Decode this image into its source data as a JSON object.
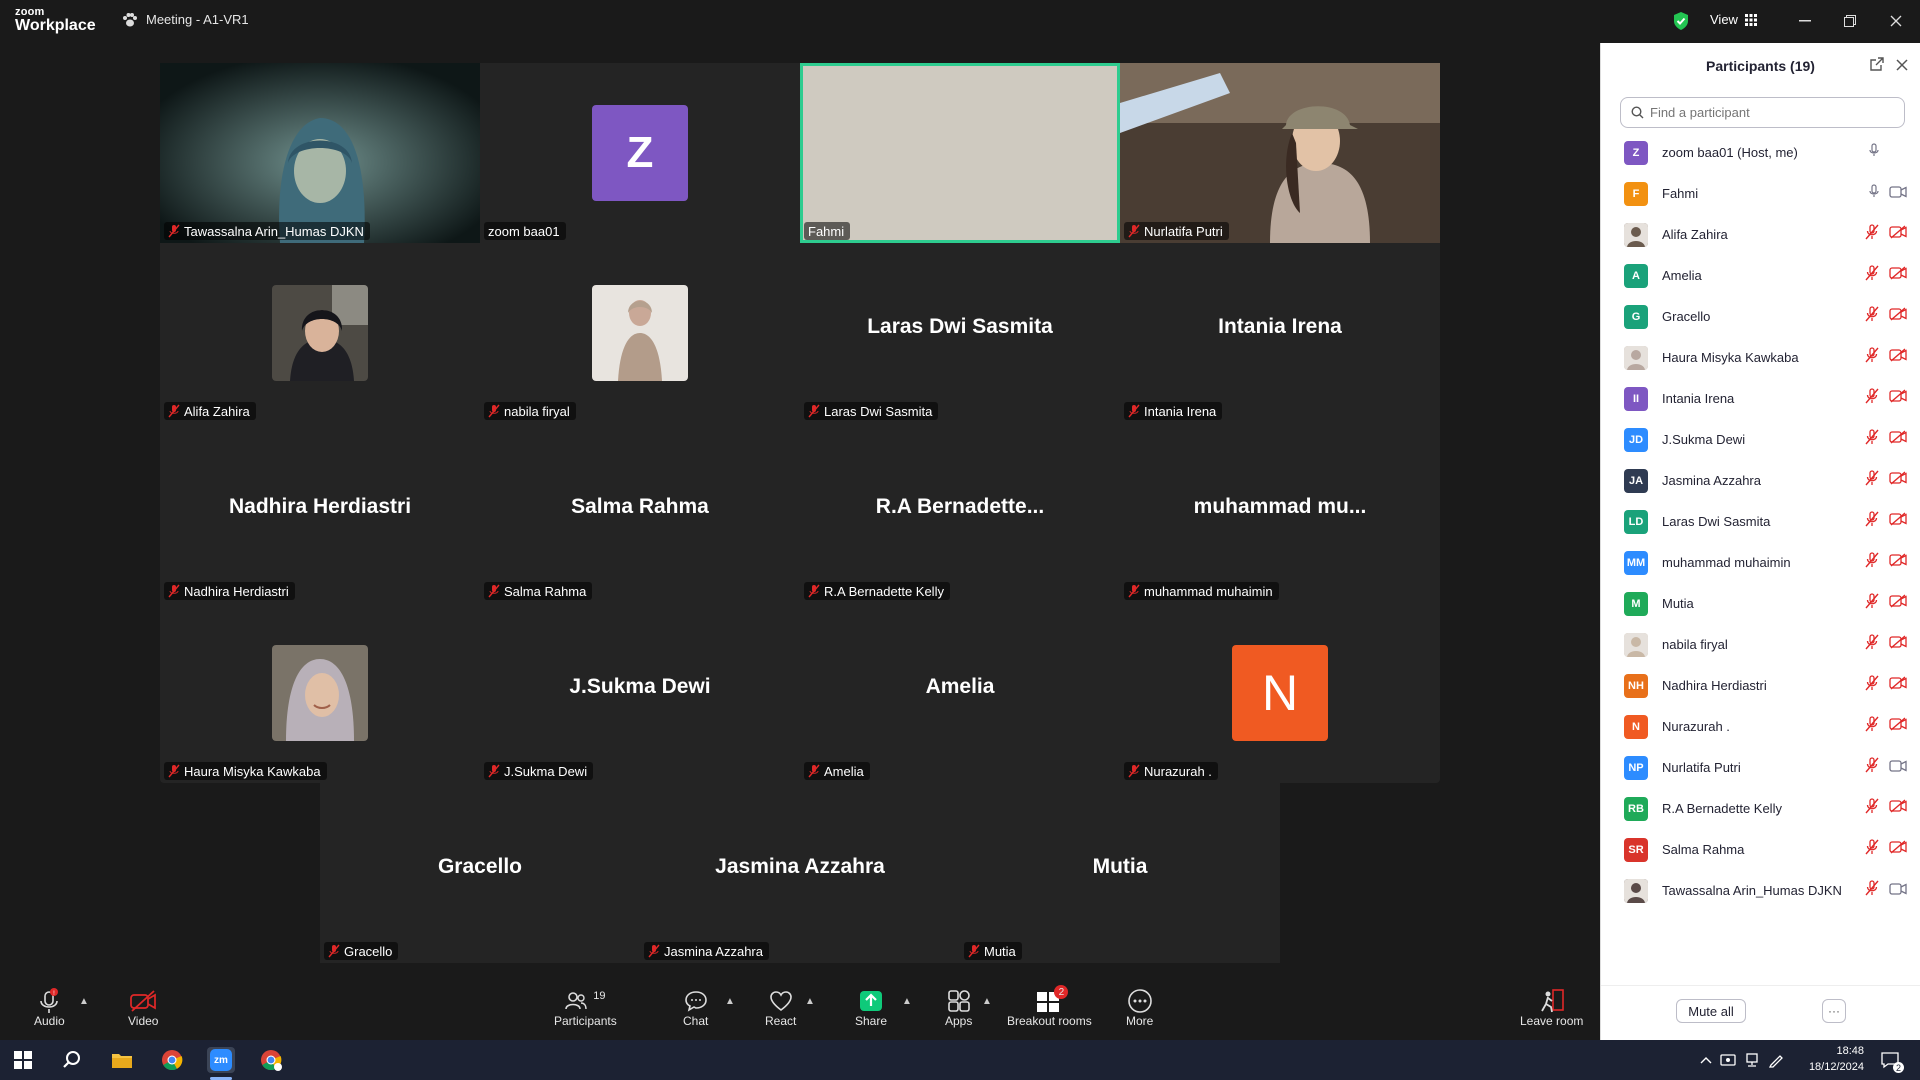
{
  "window": {
    "app_name_top": "zoom",
    "app_name_bottom": "Workplace",
    "meeting_title": "Meeting - A1-VR1",
    "view_label": "View"
  },
  "gallery": {
    "tiles": [
      {
        "name": "Tawassalna Arin_Humas DJKN",
        "big": "",
        "type": "video"
      },
      {
        "name": "zoom baa01",
        "big": "",
        "type": "letter",
        "letter": "Z",
        "color": "#7e57c2"
      },
      {
        "name": "Fahmi",
        "big": "",
        "type": "video-active"
      },
      {
        "name": "Nurlatifa Putri",
        "big": "",
        "type": "video"
      },
      {
        "name": "Alifa Zahira",
        "big": "",
        "type": "photo"
      },
      {
        "name": "nabila firyal",
        "big": "",
        "type": "photo"
      },
      {
        "name": "Laras Dwi Sasmita",
        "big": "Laras Dwi Sasmita",
        "type": "text"
      },
      {
        "name": "Intania Irena",
        "big": "Intania Irena",
        "type": "text"
      },
      {
        "name": "Nadhira Herdiastri",
        "big": "Nadhira Herdiastri",
        "type": "text"
      },
      {
        "name": "Salma Rahma",
        "big": "Salma Rahma",
        "type": "text"
      },
      {
        "name": "R.A Bernadette Kelly",
        "big": "R.A  Bernadette...",
        "type": "text"
      },
      {
        "name": "muhammad muhaimin",
        "big": "muhammad  mu...",
        "type": "text"
      },
      {
        "name": "Haura Misyka Kawkaba",
        "big": "",
        "type": "photo"
      },
      {
        "name": "J.Sukma Dewi",
        "big": "J.Sukma Dewi",
        "type": "text"
      },
      {
        "name": "Amelia",
        "big": "Amelia",
        "type": "text"
      },
      {
        "name": "Nurazurah .",
        "big": "",
        "type": "letter",
        "letter": "N",
        "color": "#f05a22"
      },
      {
        "name": "Gracello",
        "big": "Gracello",
        "type": "text"
      },
      {
        "name": "Jasmina Azzahra",
        "big": "Jasmina Azzahra",
        "type": "text"
      },
      {
        "name": "Mutia",
        "big": "Mutia",
        "type": "text"
      }
    ]
  },
  "toolbar": {
    "audio": "Audio",
    "video": "Video",
    "participants": "Participants",
    "participants_count": "19",
    "chat": "Chat",
    "react": "React",
    "share": "Share",
    "apps": "Apps",
    "breakout": "Breakout rooms",
    "breakout_badge": "2",
    "more": "More",
    "leave": "Leave room"
  },
  "panel": {
    "title": "Participants (19)",
    "search_placeholder": "Find a participant",
    "mute_all": "Mute all",
    "more_dots": "···",
    "participants": [
      {
        "name": "zoom baa01 (Host, me)",
        "initials": "Z",
        "color": "#7e57c2",
        "mic": "on",
        "cam": "none"
      },
      {
        "name": "Fahmi",
        "initials": "F",
        "color": "#f29111",
        "mic": "on",
        "cam": "on"
      },
      {
        "name": "Alifa Zahira",
        "initials": "",
        "color": "#6b5b4e",
        "mic": "off",
        "cam": "off"
      },
      {
        "name": "Amelia",
        "initials": "A",
        "color": "#1aa27a",
        "mic": "off",
        "cam": "off"
      },
      {
        "name": "Gracello",
        "initials": "G",
        "color": "#1aa27a",
        "mic": "off",
        "cam": "off"
      },
      {
        "name": "Haura Misyka Kawkaba",
        "initials": "",
        "color": "#b8a8a0",
        "mic": "off",
        "cam": "off"
      },
      {
        "name": "Intania Irena",
        "initials": "II",
        "color": "#7e57c2",
        "mic": "off",
        "cam": "off"
      },
      {
        "name": "J.Sukma Dewi",
        "initials": "JD",
        "color": "#2d8cff",
        "mic": "off",
        "cam": "off"
      },
      {
        "name": "Jasmina Azzahra",
        "initials": "JA",
        "color": "#2f3b52",
        "mic": "off",
        "cam": "off"
      },
      {
        "name": "Laras Dwi Sasmita",
        "initials": "LD",
        "color": "#1aa27a",
        "mic": "off",
        "cam": "off"
      },
      {
        "name": "muhammad muhaimin",
        "initials": "MM",
        "color": "#2d8cff",
        "mic": "off",
        "cam": "off"
      },
      {
        "name": "Mutia",
        "initials": "M",
        "color": "#1faa59",
        "mic": "off",
        "cam": "off"
      },
      {
        "name": "nabila firyal",
        "initials": "",
        "color": "#c9b8a6",
        "mic": "off",
        "cam": "off"
      },
      {
        "name": "Nadhira Herdiastri",
        "initials": "NH",
        "color": "#e8701a",
        "mic": "off",
        "cam": "off"
      },
      {
        "name": "Nurazurah .",
        "initials": "N",
        "color": "#f05a22",
        "mic": "off",
        "cam": "off"
      },
      {
        "name": "Nurlatifa Putri",
        "initials": "NP",
        "color": "#2d8cff",
        "mic": "off",
        "cam": "on"
      },
      {
        "name": "R.A Bernadette Kelly",
        "initials": "RB",
        "color": "#1faa59",
        "mic": "off",
        "cam": "off"
      },
      {
        "name": "Salma Rahma",
        "initials": "SR",
        "color": "#d9342b",
        "mic": "off",
        "cam": "off"
      },
      {
        "name": "Tawassalna Arin_Humas DJKN",
        "initials": "",
        "color": "#5a4a48",
        "mic": "off",
        "cam": "on"
      }
    ]
  },
  "taskbar": {
    "time": "18:48",
    "date": "18/12/2024",
    "notif_count": "2",
    "zoom_label": "zm"
  },
  "colors": {
    "accent_green": "#2ecc8f",
    "mute_red": "#e02828",
    "share_green": "#0fca7a"
  }
}
